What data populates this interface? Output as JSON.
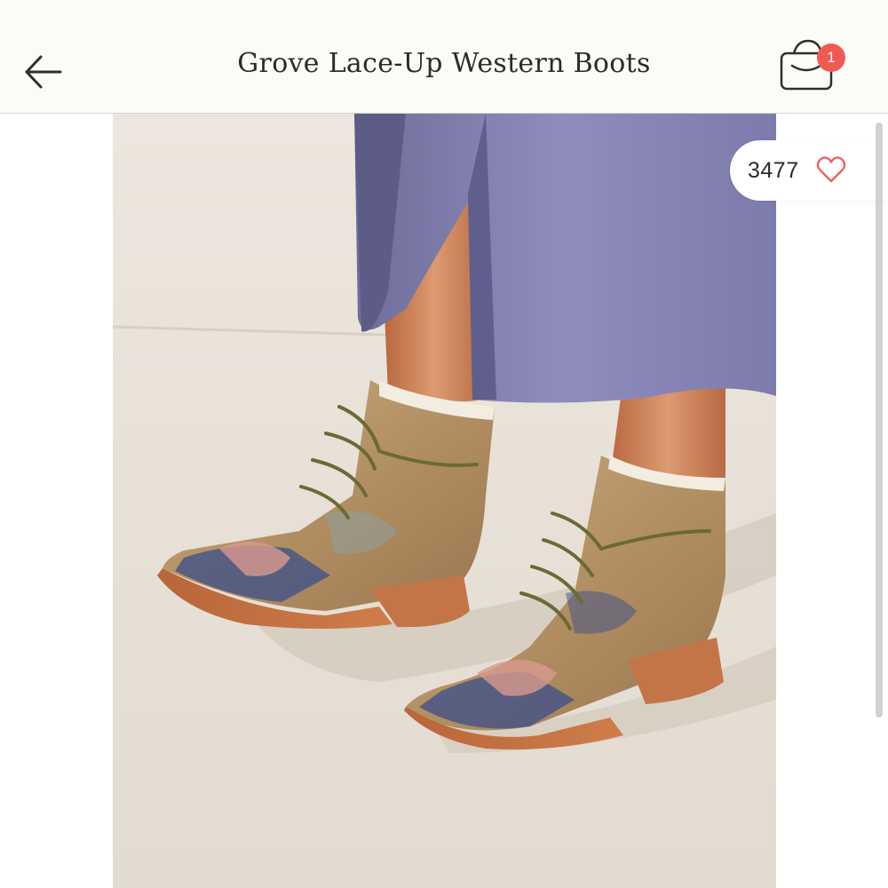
{
  "header": {
    "title": "Grove Lace-Up Western Boots",
    "back_icon": "arrow-left-icon",
    "bag_icon": "shopping-bag-icon",
    "bag_count": "1",
    "badge_color": "#f05a55"
  },
  "product": {
    "image_subject": "product-photo",
    "likes": "3477",
    "like_icon": "heart-outline-icon",
    "like_color": "#e8645f"
  }
}
